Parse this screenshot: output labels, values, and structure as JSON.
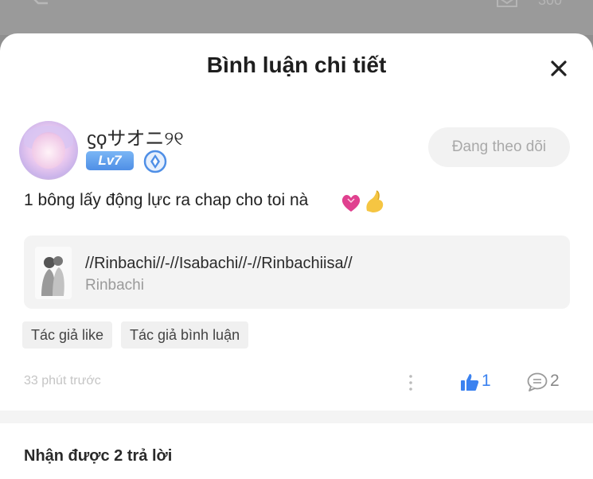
{
  "backdrop": {
    "count": "300"
  },
  "sheet": {
    "title": "Bình luận chi tiết"
  },
  "comment": {
    "username": "ϛϙサオニ୨୧",
    "level": "Lv7",
    "follow_label": "Đang theo dõi",
    "text": "1 bông lấy động lực ra chap cho toi nà",
    "story": {
      "title": "//Rinbachi//-//Isabachi//-//Rinbachiisa//",
      "author": "Rinbachi"
    },
    "tags": [
      "Tác giả like",
      "Tác giả bình luận"
    ],
    "time": "33 phút trước",
    "likes": "1",
    "replies": "2"
  },
  "replies_heading": "Nhận được 2 trả lời",
  "icons": {
    "close": "close-icon",
    "shield": "shield-icon",
    "like": "thumbs-up-icon",
    "reply": "comment-bubble-icon",
    "more": "more-vertical-icon"
  },
  "colors": {
    "accent": "#3b82f0",
    "level_badge": "#4f8fe6"
  }
}
